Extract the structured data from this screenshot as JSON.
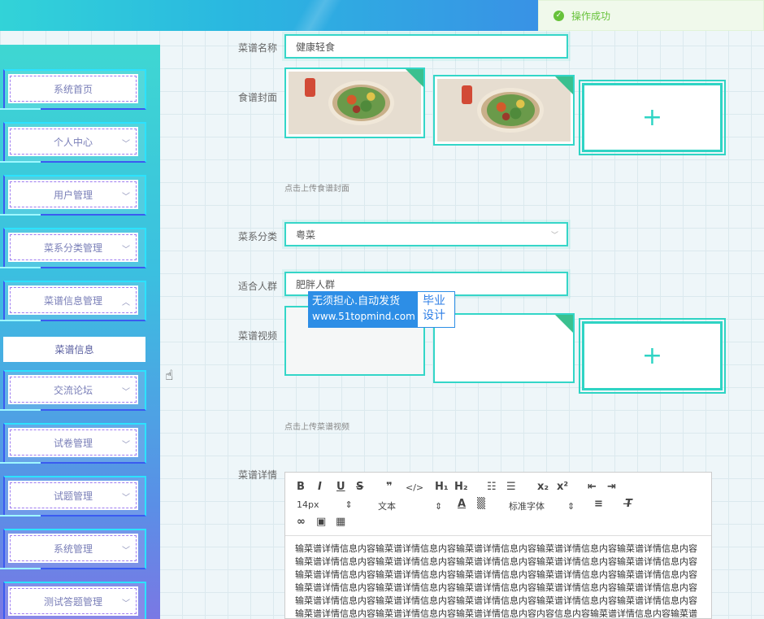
{
  "toast": {
    "icon": "check-circle-icon",
    "message": "操作成功"
  },
  "sidebar": {
    "items": [
      {
        "label": "系统首页",
        "has_chevron": false
      },
      {
        "label": "个人中心",
        "has_chevron": true
      },
      {
        "label": "用户管理",
        "has_chevron": true
      },
      {
        "label": "菜系分类管理",
        "has_chevron": true
      },
      {
        "label": "菜谱信息管理",
        "has_chevron": true,
        "expanded": true
      },
      {
        "label": "交流论坛",
        "has_chevron": true
      },
      {
        "label": "试卷管理",
        "has_chevron": true
      },
      {
        "label": "试题管理",
        "has_chevron": true
      },
      {
        "label": "系统管理",
        "has_chevron": true
      },
      {
        "label": "测试答题管理",
        "has_chevron": true
      }
    ],
    "submenu_item": "菜谱信息"
  },
  "form": {
    "name": {
      "label": "菜谱名称",
      "value": "健康轻食"
    },
    "cover": {
      "label": "食谱封面",
      "hint": "点击上传食谱封面",
      "add_icon": "plus-icon"
    },
    "category": {
      "label": "菜系分类",
      "value": "粤菜"
    },
    "crowd": {
      "label": "适合人群",
      "value": "肥胖人群"
    },
    "video": {
      "label": "菜谱视频",
      "hint": "点击上传菜谱视频",
      "add_icon": "plus-icon"
    },
    "detail": {
      "label": "菜谱详情"
    }
  },
  "watermark": {
    "line1": "无须担心.自动发货",
    "line2": "www.51topmind.com",
    "side1": "毕业",
    "side2": "设计"
  },
  "editor": {
    "font_size": "14px",
    "paragraph": "文本",
    "font_family": "标准字体",
    "content": "输菜谱详情信息内容输菜谱详情信息内容输菜谱详情信息内容输菜谱详情信息内容输菜谱详情信息内容输菜谱详情信息内容输菜谱详情信息内容输菜谱详情信息内容输菜谱详情信息内容输菜谱详情信息内容输菜谱详情信息内容输菜谱详情信息内容输菜谱详情信息内容输菜谱详情信息内容输菜谱详情信息内容输菜谱详情信息内容输菜谱详情信息内容输菜谱详情信息内容输菜谱详情信息内容输菜谱详情信息内容输菜谱详情信息内容输菜谱详情信息内容输菜谱详情信息内容输菜谱详情信息内容输菜谱详情信息内容输菜谱详情信息内容输菜谱详情信息内容输菜谱详情信息内容内容信息内容输菜谱详情信息内容输菜谱详情信息内容输菜谱详情信息内容输菜谱详情信息内容输菜谱详情信息内容"
  },
  "colors": {
    "accent": "#33d6c8",
    "success": "#67c23a",
    "menu_text": "#7a7fb8"
  }
}
